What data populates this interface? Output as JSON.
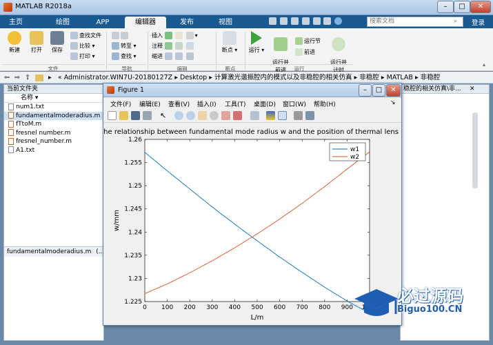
{
  "window": {
    "title": "MATLAB R2018a"
  },
  "tabs": [
    "主页",
    "绘图",
    "APP",
    "编辑器",
    "发布",
    "视图"
  ],
  "active_tab": "编辑器",
  "search": {
    "placeholder": "搜索文档"
  },
  "login_label": "登录",
  "ribbon": {
    "file": {
      "new": "新建",
      "open": "打开",
      "save": "保存",
      "find_files": "查找文件",
      "compare": "比较",
      "print": "打印",
      "group": "文件"
    },
    "nav": {
      "goto": "转至",
      "find": "查找",
      "group": "导航"
    },
    "edit": {
      "insert": "插入",
      "comment": "注释",
      "indent": "缩进",
      "group": "编辑"
    },
    "breakpoints": {
      "label": "断点",
      "group": "断点"
    },
    "run": {
      "run": "运行",
      "run_advance": "运行并\n前进",
      "run_section": "运行节",
      "advance": "前进",
      "run_time": "运行并\n计时",
      "group": "运行"
    }
  },
  "address": {
    "crumbs": [
      "«",
      "Administrator.WIN7U-20180127Z",
      "Desktop",
      "计算激光谐振腔内的模式以及非稳腔的相关仿真",
      "非稳腔",
      "MATLAB",
      "非稳腔"
    ]
  },
  "left_panel": {
    "title": "当前文件夹",
    "column": "名称",
    "files": [
      "num1.txt",
      "fundamentalmoderadius.m",
      "fTtoM.m",
      "fresnel number.m",
      "fresnel_number.m",
      "A1.txt"
    ],
    "selected_index": 1,
    "details": "fundamentalmoderadius.m",
    "details_suffix": "(..."
  },
  "right_panel": {
    "title": "稳腔的相关仿真\\非..."
  },
  "figure": {
    "title": "Figure 1",
    "menu": [
      "文件(F)",
      "编辑(E)",
      "查看(V)",
      "插入(I)",
      "工具(T)",
      "桌面(D)",
      "窗口(W)",
      "帮助(H)"
    ]
  },
  "watermark": {
    "brand": "必过源码",
    "site": "Biguo100.CN"
  },
  "colors": {
    "w1": "#0072bd",
    "w2": "#d95319",
    "tabbar": "#1a5a92"
  },
  "chart_data": {
    "type": "line",
    "title": "The relationship between fundamental mode radius w and the position of thermal lens",
    "xlabel": "L/m",
    "ylabel": "w/mm",
    "xlim": [
      0,
      1000
    ],
    "ylim": [
      1.225,
      1.26
    ],
    "xticks": [
      0,
      100,
      200,
      300,
      400,
      500,
      600,
      700,
      800,
      900,
      1000
    ],
    "xtick_labels": [
      "0",
      "100",
      "200",
      "300",
      "400",
      "500",
      "600",
      "700",
      "800",
      "900",
      "1000"
    ],
    "yticks": [
      1.225,
      1.23,
      1.235,
      1.24,
      1.245,
      1.25,
      1.255,
      1.26
    ],
    "ytick_labels": [
      "1.225",
      "1.23",
      "1.235",
      "1.24",
      "1.245",
      "1.25",
      "1.255",
      "1.26"
    ],
    "legend": "top-right",
    "x": [
      0,
      100,
      200,
      300,
      400,
      500,
      600,
      700,
      800,
      900,
      1000
    ],
    "series": [
      {
        "name": "w1",
        "values": [
          1.2572,
          1.2532,
          1.2493,
          1.2454,
          1.2417,
          1.2381,
          1.2346,
          1.2313,
          1.2281,
          1.2251,
          1.2225
        ]
      },
      {
        "name": "w2",
        "values": [
          1.2267,
          1.2288,
          1.2312,
          1.2338,
          1.2366,
          1.2396,
          1.2428,
          1.2462,
          1.2498,
          1.2536,
          1.2573
        ]
      }
    ]
  }
}
